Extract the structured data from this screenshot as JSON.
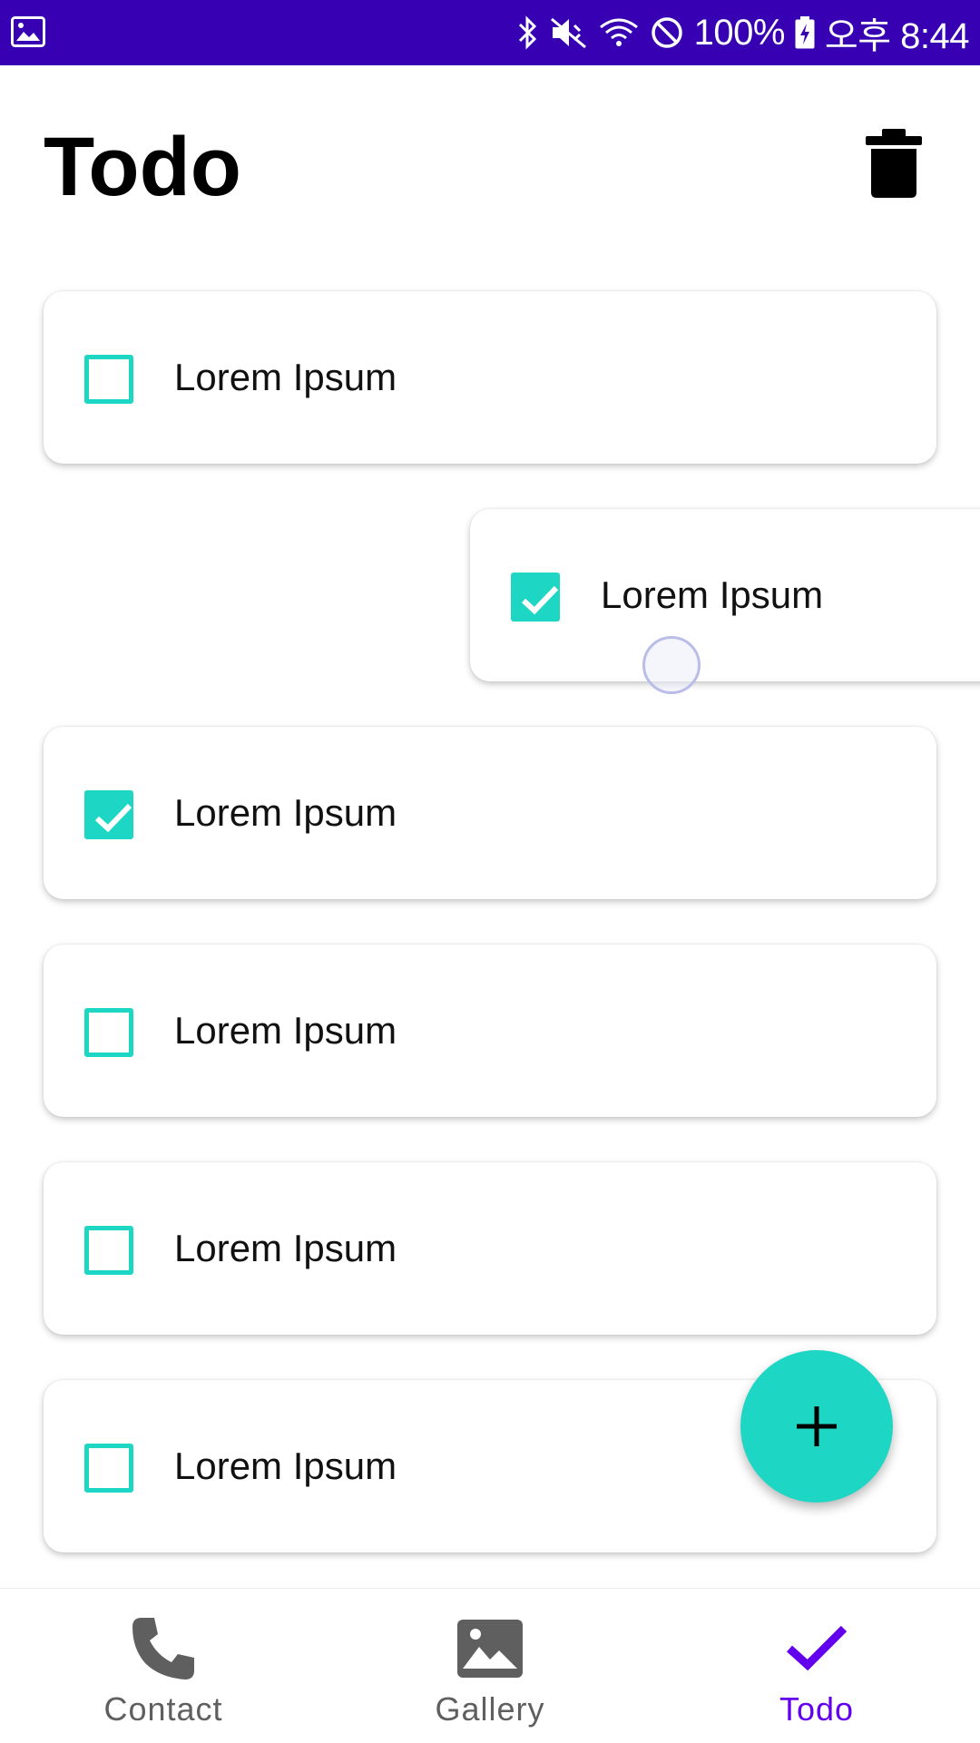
{
  "status_bar": {
    "battery": "100%",
    "time": "오후 8:44",
    "icons": [
      "gallery-notification-icon",
      "bluetooth-icon",
      "mute-icon",
      "wifi-icon",
      "do-not-disturb-icon",
      "battery-charging-icon"
    ]
  },
  "header": {
    "title": "Todo",
    "action_icon": "trash-icon"
  },
  "todos": [
    {
      "label": "Lorem Ipsum",
      "checked": false
    },
    {
      "label": "Lorem Ipsum",
      "checked": true,
      "swiped": true
    },
    {
      "label": "Lorem Ipsum",
      "checked": true
    },
    {
      "label": "Lorem Ipsum",
      "checked": false
    },
    {
      "label": "Lorem Ipsum",
      "checked": false
    },
    {
      "label": "Lorem Ipsum",
      "checked": false
    }
  ],
  "fab": {
    "icon": "plus-icon"
  },
  "bottom_nav": {
    "items": [
      {
        "label": "Contact",
        "icon": "phone-icon",
        "active": false
      },
      {
        "label": "Gallery",
        "icon": "image-icon",
        "active": false
      },
      {
        "label": "Todo",
        "icon": "check-icon",
        "active": true
      }
    ]
  },
  "colors": {
    "status_bar": "#3700b3",
    "accent": "#1ed6c4",
    "active_nav": "#6200ee",
    "inactive_nav": "#5f5f5f"
  }
}
